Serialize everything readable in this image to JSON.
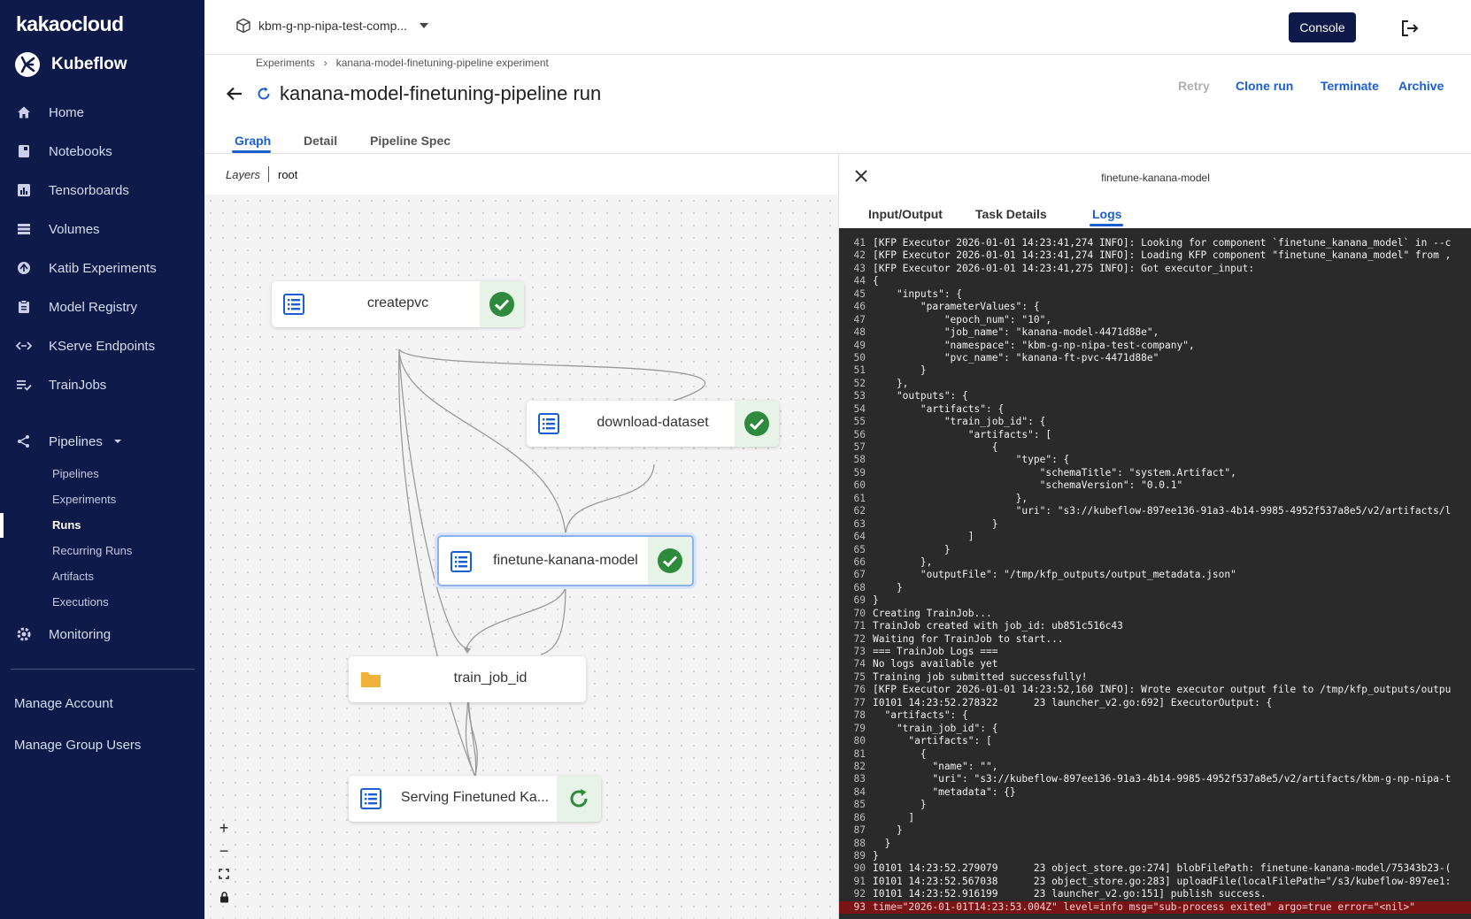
{
  "sidebar": {
    "brand": "kakaocloud",
    "product": "Kubeflow",
    "items": [
      {
        "label": "Home",
        "icon": "home-icon"
      },
      {
        "label": "Notebooks",
        "icon": "notebook-icon"
      },
      {
        "label": "Tensorboards",
        "icon": "chart-icon"
      },
      {
        "label": "Volumes",
        "icon": "storage-icon"
      },
      {
        "label": "Katib Experiments",
        "icon": "katib-icon"
      },
      {
        "label": "Model Registry",
        "icon": "clipboard-icon"
      },
      {
        "label": "KServe Endpoints",
        "icon": "code-arrows-icon"
      },
      {
        "label": "TrainJobs",
        "icon": "list-check-icon"
      },
      {
        "label": "Pipelines",
        "icon": "pipeline-icon"
      }
    ],
    "pipelines_sub": [
      "Pipelines",
      "Experiments",
      "Runs",
      "Recurring Runs",
      "Artifacts",
      "Executions"
    ],
    "active_sub": "Runs",
    "monitoring": "Monitoring",
    "manage_account": "Manage Account",
    "manage_group_users": "Manage Group Users"
  },
  "topbar": {
    "namespace": "kbm-g-np-nipa-test-comp...",
    "console": "Console"
  },
  "header": {
    "breadcrumb": [
      "Experiments",
      "kanana-model-finetuning-pipeline experiment"
    ],
    "breadcrumb_sep": "›",
    "title": "kanana-model-finetuning-pipeline run",
    "actions": {
      "retry": "Retry",
      "clone": "Clone run",
      "terminate": "Terminate",
      "archive": "Archive"
    }
  },
  "tabs": [
    "Graph",
    "Detail",
    "Pipeline Spec"
  ],
  "graph": {
    "layers_label": "Layers",
    "layer": "root",
    "nodes": [
      {
        "label": "createpvc",
        "kind": "execution",
        "status": "succeeded"
      },
      {
        "label": "download-dataset",
        "kind": "execution",
        "status": "succeeded"
      },
      {
        "label": "finetune-kanana-model",
        "kind": "execution",
        "status": "succeeded",
        "selected": true
      },
      {
        "label": "train_job_id",
        "kind": "artifact"
      },
      {
        "label": "Serving Finetuned Ka...",
        "kind": "execution",
        "status": "pending"
      }
    ],
    "zoom_controls": [
      "+",
      "−"
    ]
  },
  "panel": {
    "title": "finetune-kanana-model",
    "tabs": [
      "Input/Output",
      "Task Details",
      "Logs"
    ],
    "active_tab": "Logs",
    "logs": [
      {
        "n": "41",
        "t": "[KFP Executor 2026-01-01 14:23:41,274 INFO]: Looking for component `finetune_kanana_model` in --c"
      },
      {
        "n": "42",
        "t": "[KFP Executor 2026-01-01 14:23:41,274 INFO]: Loading KFP component \"finetune_kanana_model\" from ,"
      },
      {
        "n": "43",
        "t": "[KFP Executor 2026-01-01 14:23:41,275 INFO]: Got executor_input:"
      },
      {
        "n": "44",
        "t": "{"
      },
      {
        "n": "45",
        "t": "    \"inputs\": {"
      },
      {
        "n": "46",
        "t": "        \"parameterValues\": {"
      },
      {
        "n": "47",
        "t": "            \"epoch_num\": \"10\","
      },
      {
        "n": "48",
        "t": "            \"job_name\": \"kanana-model-4471d88e\","
      },
      {
        "n": "49",
        "t": "            \"namespace\": \"kbm-g-np-nipa-test-company\","
      },
      {
        "n": "50",
        "t": "            \"pvc_name\": \"kanana-ft-pvc-4471d88e\""
      },
      {
        "n": "51",
        "t": "        }"
      },
      {
        "n": "52",
        "t": "    },"
      },
      {
        "n": "53",
        "t": "    \"outputs\": {"
      },
      {
        "n": "54",
        "t": "        \"artifacts\": {"
      },
      {
        "n": "55",
        "t": "            \"train_job_id\": {"
      },
      {
        "n": "56",
        "t": "                \"artifacts\": ["
      },
      {
        "n": "57",
        "t": "                    {"
      },
      {
        "n": "58",
        "t": "                        \"type\": {"
      },
      {
        "n": "59",
        "t": "                            \"schemaTitle\": \"system.Artifact\","
      },
      {
        "n": "60",
        "t": "                            \"schemaVersion\": \"0.0.1\""
      },
      {
        "n": "61",
        "t": "                        },"
      },
      {
        "n": "62",
        "t": "                        \"uri\": \"s3://kubeflow-897ee136-91a3-4b14-9985-4952f537a8e5/v2/artifacts/l"
      },
      {
        "n": "63",
        "t": "                    }"
      },
      {
        "n": "64",
        "t": "                ]"
      },
      {
        "n": "65",
        "t": "            }"
      },
      {
        "n": "66",
        "t": "        },"
      },
      {
        "n": "67",
        "t": "        \"outputFile\": \"/tmp/kfp_outputs/output_metadata.json\""
      },
      {
        "n": "68",
        "t": "    }"
      },
      {
        "n": "69",
        "t": "}"
      },
      {
        "n": "70",
        "t": "Creating TrainJob..."
      },
      {
        "n": "71",
        "t": "TrainJob created with job_id: ub851c516c43"
      },
      {
        "n": "72",
        "t": "Waiting for TrainJob to start..."
      },
      {
        "n": "73",
        "t": "=== TrainJob Logs ==="
      },
      {
        "n": "74",
        "t": "No logs available yet"
      },
      {
        "n": "75",
        "t": "Training job submitted successfully!"
      },
      {
        "n": "76",
        "t": "[KFP Executor 2026-01-01 14:23:52,160 INFO]: Wrote executor output file to /tmp/kfp_outputs/outpu"
      },
      {
        "n": "77",
        "t": "I0101 14:23:52.278322      23 launcher_v2.go:692] ExecutorOutput: {"
      },
      {
        "n": "78",
        "t": "  \"artifacts\": {"
      },
      {
        "n": "79",
        "t": "    \"train_job_id\": {"
      },
      {
        "n": "80",
        "t": "      \"artifacts\": ["
      },
      {
        "n": "81",
        "t": "        {"
      },
      {
        "n": "82",
        "t": "          \"name\": \"\","
      },
      {
        "n": "83",
        "t": "          \"uri\": \"s3://kubeflow-897ee136-91a3-4b14-9985-4952f537a8e5/v2/artifacts/kbm-g-np-nipa-t"
      },
      {
        "n": "84",
        "t": "          \"metadata\": {}"
      },
      {
        "n": "85",
        "t": "        }"
      },
      {
        "n": "86",
        "t": "      ]"
      },
      {
        "n": "87",
        "t": "    }"
      },
      {
        "n": "88",
        "t": "  }"
      },
      {
        "n": "89",
        "t": "}"
      },
      {
        "n": "90",
        "t": "I0101 14:23:52.279079      23 object_store.go:274] blobFilePath: finetune-kanana-model/75343b23-("
      },
      {
        "n": "91",
        "t": "I0101 14:23:52.567038      23 object_store.go:283] uploadFile(localFilePath=\"/s3/kubeflow-897ee1:"
      },
      {
        "n": "92",
        "t": "I0101 14:23:52.916199      23 launcher_v2.go:151] publish success."
      },
      {
        "n": "93",
        "t": "time=\"2026-01-01T14:23:53.004Z\" level=info msg=\"sub-process exited\" argo=true error=\"<nil>\"",
        "error": true
      }
    ]
  },
  "colors": {
    "sidebar_bg": "#0e1a4a",
    "accent": "#1a5fd0",
    "success": "#2e7d32",
    "log_bg": "#2a2a2a",
    "log_error_bg": "#7a1313"
  }
}
